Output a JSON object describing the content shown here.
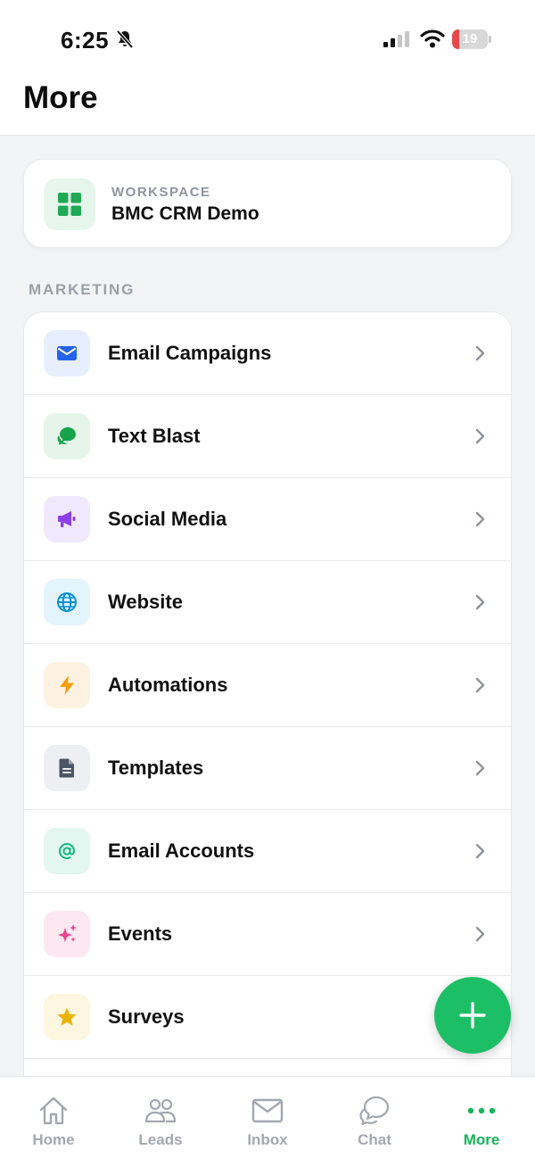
{
  "status_bar": {
    "time": "6:25",
    "battery_level": "19",
    "battery_fraction": 0.19,
    "icons": [
      "bell-slash-icon",
      "cellular-signal-icon",
      "wifi-icon",
      "battery-icon"
    ]
  },
  "header": {
    "title": "More"
  },
  "workspace": {
    "label": "WORKSPACE",
    "name": "BMC CRM Demo",
    "icon": "grid-icon"
  },
  "marketing": {
    "section_title": "MARKETING",
    "items": [
      {
        "label": "Email Campaigns",
        "icon": "envelope-icon",
        "color": "#2563eb",
        "bg": "#e7efff"
      },
      {
        "label": "Text Blast",
        "icon": "chat-bubble-icon",
        "color": "#16a34a",
        "bg": "#e5f5ea"
      },
      {
        "label": "Social Media",
        "icon": "megaphone-icon",
        "color": "#8b3fe6",
        "bg": "#f0e9fd"
      },
      {
        "label": "Website",
        "icon": "globe-icon",
        "color": "#0891d6",
        "bg": "#e4f4fc"
      },
      {
        "label": "Automations",
        "icon": "lightning-icon",
        "color": "#f59e0b",
        "bg": "#fdf2e2"
      },
      {
        "label": "Templates",
        "icon": "document-icon",
        "color": "#4b5563",
        "bg": "#eeeff2"
      },
      {
        "label": "Email Accounts",
        "icon": "at-sign-icon",
        "color": "#10b981",
        "bg": "#e3f6ef"
      },
      {
        "label": "Events",
        "icon": "sparkles-icon",
        "color": "#e6448c",
        "bg": "#fde8f1"
      },
      {
        "label": "Surveys",
        "icon": "star-icon",
        "color": "#eab308",
        "bg": "#fdf6e0"
      }
    ]
  },
  "fab": {
    "icon": "plus-icon",
    "color": "#1dbf66"
  },
  "tab_bar": {
    "active_tab": "More",
    "tabs": [
      {
        "label": "Home",
        "icon": "home-icon"
      },
      {
        "label": "Leads",
        "icon": "users-icon"
      },
      {
        "label": "Inbox",
        "icon": "inbox-icon"
      },
      {
        "label": "Chat",
        "icon": "chat-icon"
      },
      {
        "label": "More",
        "icon": "more-dots-icon"
      }
    ]
  },
  "colors": {
    "accent": "#18b45a",
    "inactive_tab": "#a3a8b0",
    "background": "#f3f4f6"
  }
}
